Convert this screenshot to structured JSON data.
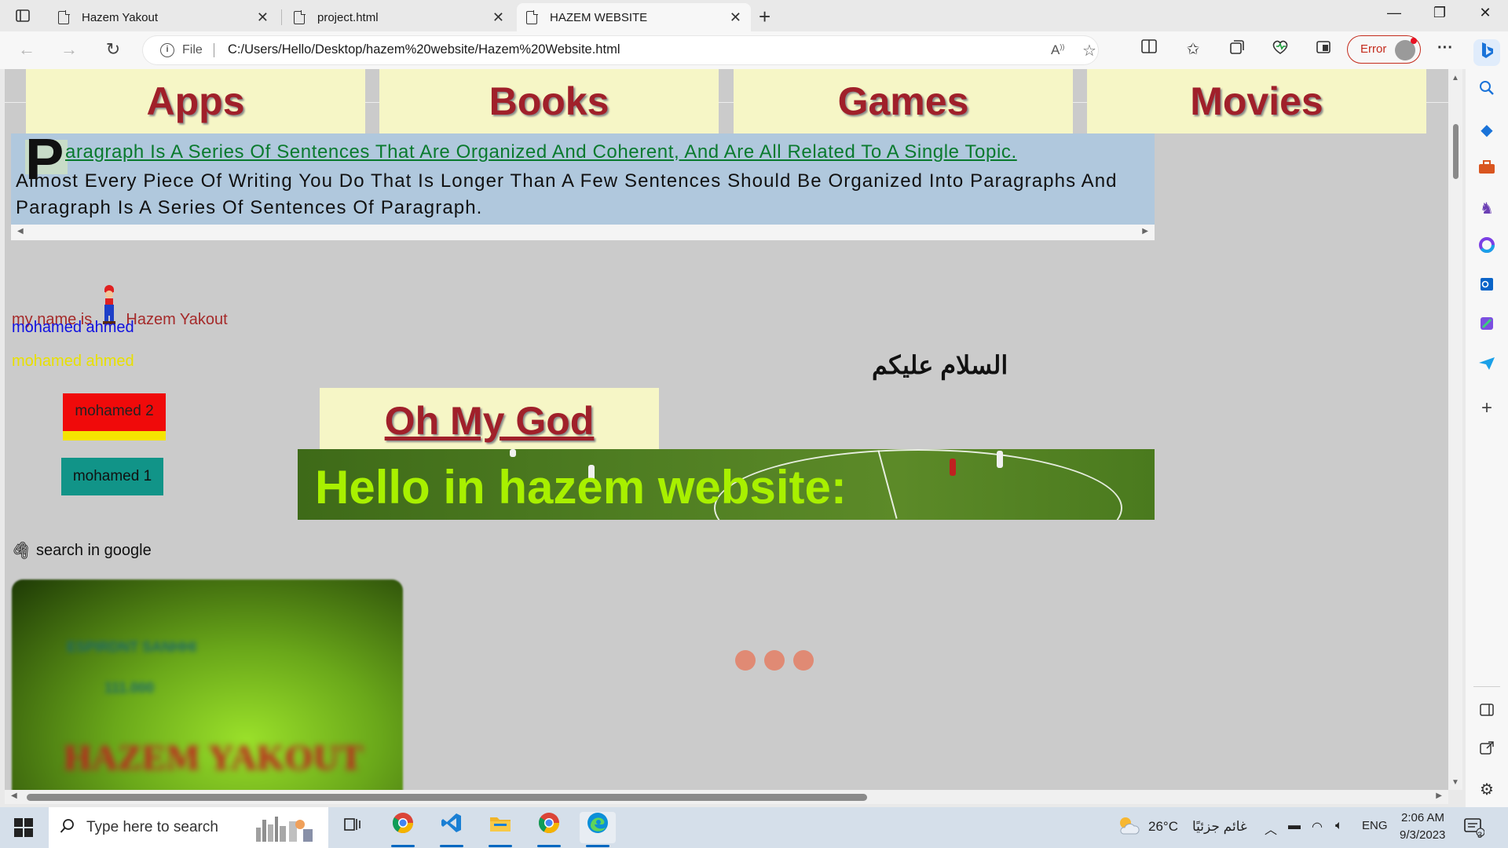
{
  "browser": {
    "tabs": [
      {
        "title": "Hazem Yakout",
        "active": false
      },
      {
        "title": "project.html",
        "active": false
      },
      {
        "title": "HAZEM WEBSITE",
        "active": true
      }
    ],
    "address": {
      "scheme_label": "File",
      "url": "C:/Users/Hello/Desktop/hazem%20website/Hazem%20Website.html"
    },
    "profile_status": "Error"
  },
  "page": {
    "menu": [
      "Apps",
      "Books",
      "Games",
      "Movies"
    ],
    "paragraph": {
      "drop_cap": "P",
      "first_line": "aragraph Is A Series Of Sentences That Are Organized And Coherent, And Are All Related To A Single Topic.",
      "rest": "Almost Every Piece Of Writing You Do That Is Longer Than A Few Sentences Should Be Organized Into Paragraphs And Paragraph Is A Series Of Sentences Of Paragraph."
    },
    "name_prefix": "my name is",
    "name_suffix": "Hazem Yakout",
    "line_blue": "mohamed ahmed",
    "line_yellow": "mohamed ahmed",
    "arabic_greeting": "السلام عليكم",
    "button_red": "mohamed 2",
    "button_teal": "mohamed 1",
    "heading_box": "Oh My God",
    "banner_text": "Hello in hazem website:",
    "search_link": "search in google",
    "blurred_card": {
      "line1": "ESPIRDNT SANHHI",
      "line2": "111.000",
      "line3": "HAZEM YAKOUT"
    }
  },
  "taskbar": {
    "search_placeholder": "Type here to search",
    "weather_temp": "26°C",
    "weather_desc": "غائم جزئيًا",
    "language": "ENG",
    "time": "2:06 AM",
    "date": "9/3/2023",
    "notification_count": "3"
  },
  "colors": {
    "menu_bg": "#f6f6c6",
    "menu_text": "#a0202a",
    "page_bg": "#cbcbcb",
    "paragraph_bg": "#b0c8dd",
    "banner_text": "#a8f000",
    "error_red": "#c42b1c"
  }
}
